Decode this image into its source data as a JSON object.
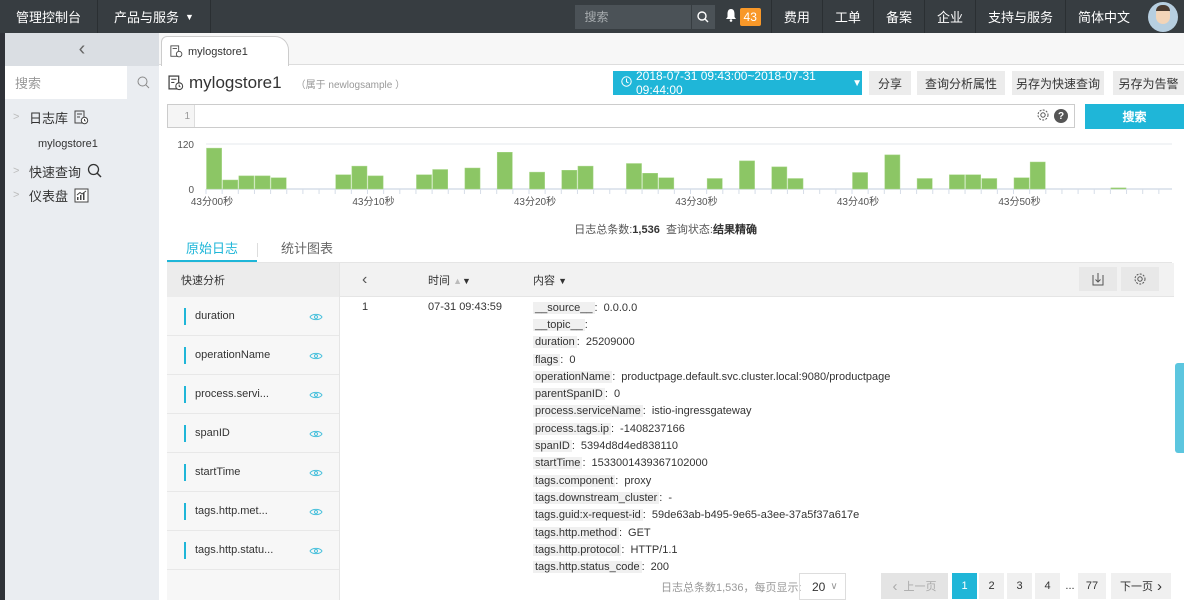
{
  "topbar": {
    "console_label": "管理控制台",
    "products_label": "产品与服务",
    "search_placeholder": "搜索",
    "notification_count": "43",
    "nav_items": [
      "费用",
      "工单",
      "备案",
      "企业",
      "支持与服务",
      "简体中文"
    ]
  },
  "sidebar": {
    "search_placeholder": "搜索",
    "items": [
      {
        "label": "日志库",
        "icon": "logstore-icon"
      },
      {
        "label": "快速查询",
        "icon": "search-icon"
      },
      {
        "label": "仪表盘",
        "icon": "dashboard-icon"
      }
    ],
    "logstore_sub": "mylogstore1"
  },
  "tab": {
    "label": "mylogstore1"
  },
  "header": {
    "title": "mylogstore1",
    "subtitle": "（属于 newlogsample ）",
    "time_range": "2018-07-31 09:43:00~2018-07-31 09:44:00",
    "buttons": [
      "分享",
      "查询分析属性",
      "另存为快速查询",
      "另存为告警"
    ]
  },
  "query": {
    "line_number": "1",
    "value": "",
    "search_button": "搜索"
  },
  "summary": {
    "total_label": "日志总条数:",
    "total_value": "1,536",
    "status_label": "查询状态:",
    "status_value": "结果精确"
  },
  "result_tabs": [
    "原始日志",
    "统计图表"
  ],
  "quick_analysis": {
    "title": "快速分析",
    "fields": [
      "duration",
      "operationName",
      "process.servi...",
      "spanID",
      "startTime",
      "tags.http.met...",
      "tags.http.statu..."
    ]
  },
  "log_table": {
    "col_time": "时间",
    "col_content": "内容",
    "rows": [
      {
        "index": "1",
        "time": "07-31 09:43:59",
        "fields": [
          {
            "k": "__source__",
            "v": "0.0.0.0"
          },
          {
            "k": "__topic__",
            "v": ""
          },
          {
            "k": "duration",
            "v": "25209000"
          },
          {
            "k": "flags",
            "v": "0"
          },
          {
            "k": "operationName",
            "v": "productpage.default.svc.cluster.local:9080/productpage"
          },
          {
            "k": "parentSpanID",
            "v": "0"
          },
          {
            "k": "process.serviceName",
            "v": "istio-ingressgateway"
          },
          {
            "k": "process.tags.ip",
            "v": "-1408237166"
          },
          {
            "k": "spanID",
            "v": "5394d8d4ed838110"
          },
          {
            "k": "startTime",
            "v": "1533001439367102000"
          },
          {
            "k": "tags.component",
            "v": "proxy"
          },
          {
            "k": "tags.downstream_cluster",
            "v": "-"
          },
          {
            "k": "tags.guid:x-request-id",
            "v": "59de63ab-b495-9e65-a3ee-37a5f37a617e"
          },
          {
            "k": "tags.http.method",
            "v": "GET"
          },
          {
            "k": "tags.http.protocol",
            "v": "HTTP/1.1"
          },
          {
            "k": "tags.http.status_code",
            "v": "200"
          }
        ]
      }
    ]
  },
  "pager": {
    "total_text": "日志总条数1,536，每页显示:",
    "page_size": "20",
    "prev": "上一页",
    "next": "下一页",
    "pages": [
      "1",
      "2",
      "3",
      "4",
      "...",
      "77"
    ],
    "current": "1"
  },
  "colors": {
    "accent": "#1fb6d8",
    "bar": "#8cc665",
    "topbar": "#373d41",
    "badge": "#f89829"
  },
  "chart_data": {
    "type": "bar",
    "title": "",
    "xlabel": "",
    "ylabel": "",
    "ylim": [
      0,
      120
    ],
    "yticks": [
      "0",
      "120"
    ],
    "xtick_labels": [
      {
        "slot": 0,
        "label": "43分00秒"
      },
      {
        "slot": 10,
        "label": "43分10秒"
      },
      {
        "slot": 20,
        "label": "43分20秒"
      },
      {
        "slot": 30,
        "label": "43分30秒"
      },
      {
        "slot": 40,
        "label": "43分40秒"
      },
      {
        "slot": 50,
        "label": "43分50秒"
      }
    ],
    "values": [
      109,
      24,
      35,
      35,
      30,
      0,
      0,
      0,
      38,
      61,
      35,
      0,
      0,
      38,
      52,
      0,
      56,
      0,
      98,
      0,
      45,
      0,
      50,
      61,
      0,
      0,
      68,
      42,
      30,
      0,
      0,
      28,
      0,
      75,
      0,
      59,
      28,
      0,
      0,
      0,
      44,
      0,
      91,
      0,
      28,
      0,
      38,
      38,
      28,
      0,
      30,
      72,
      0,
      0,
      0,
      0,
      3,
      0,
      0,
      0
    ]
  }
}
